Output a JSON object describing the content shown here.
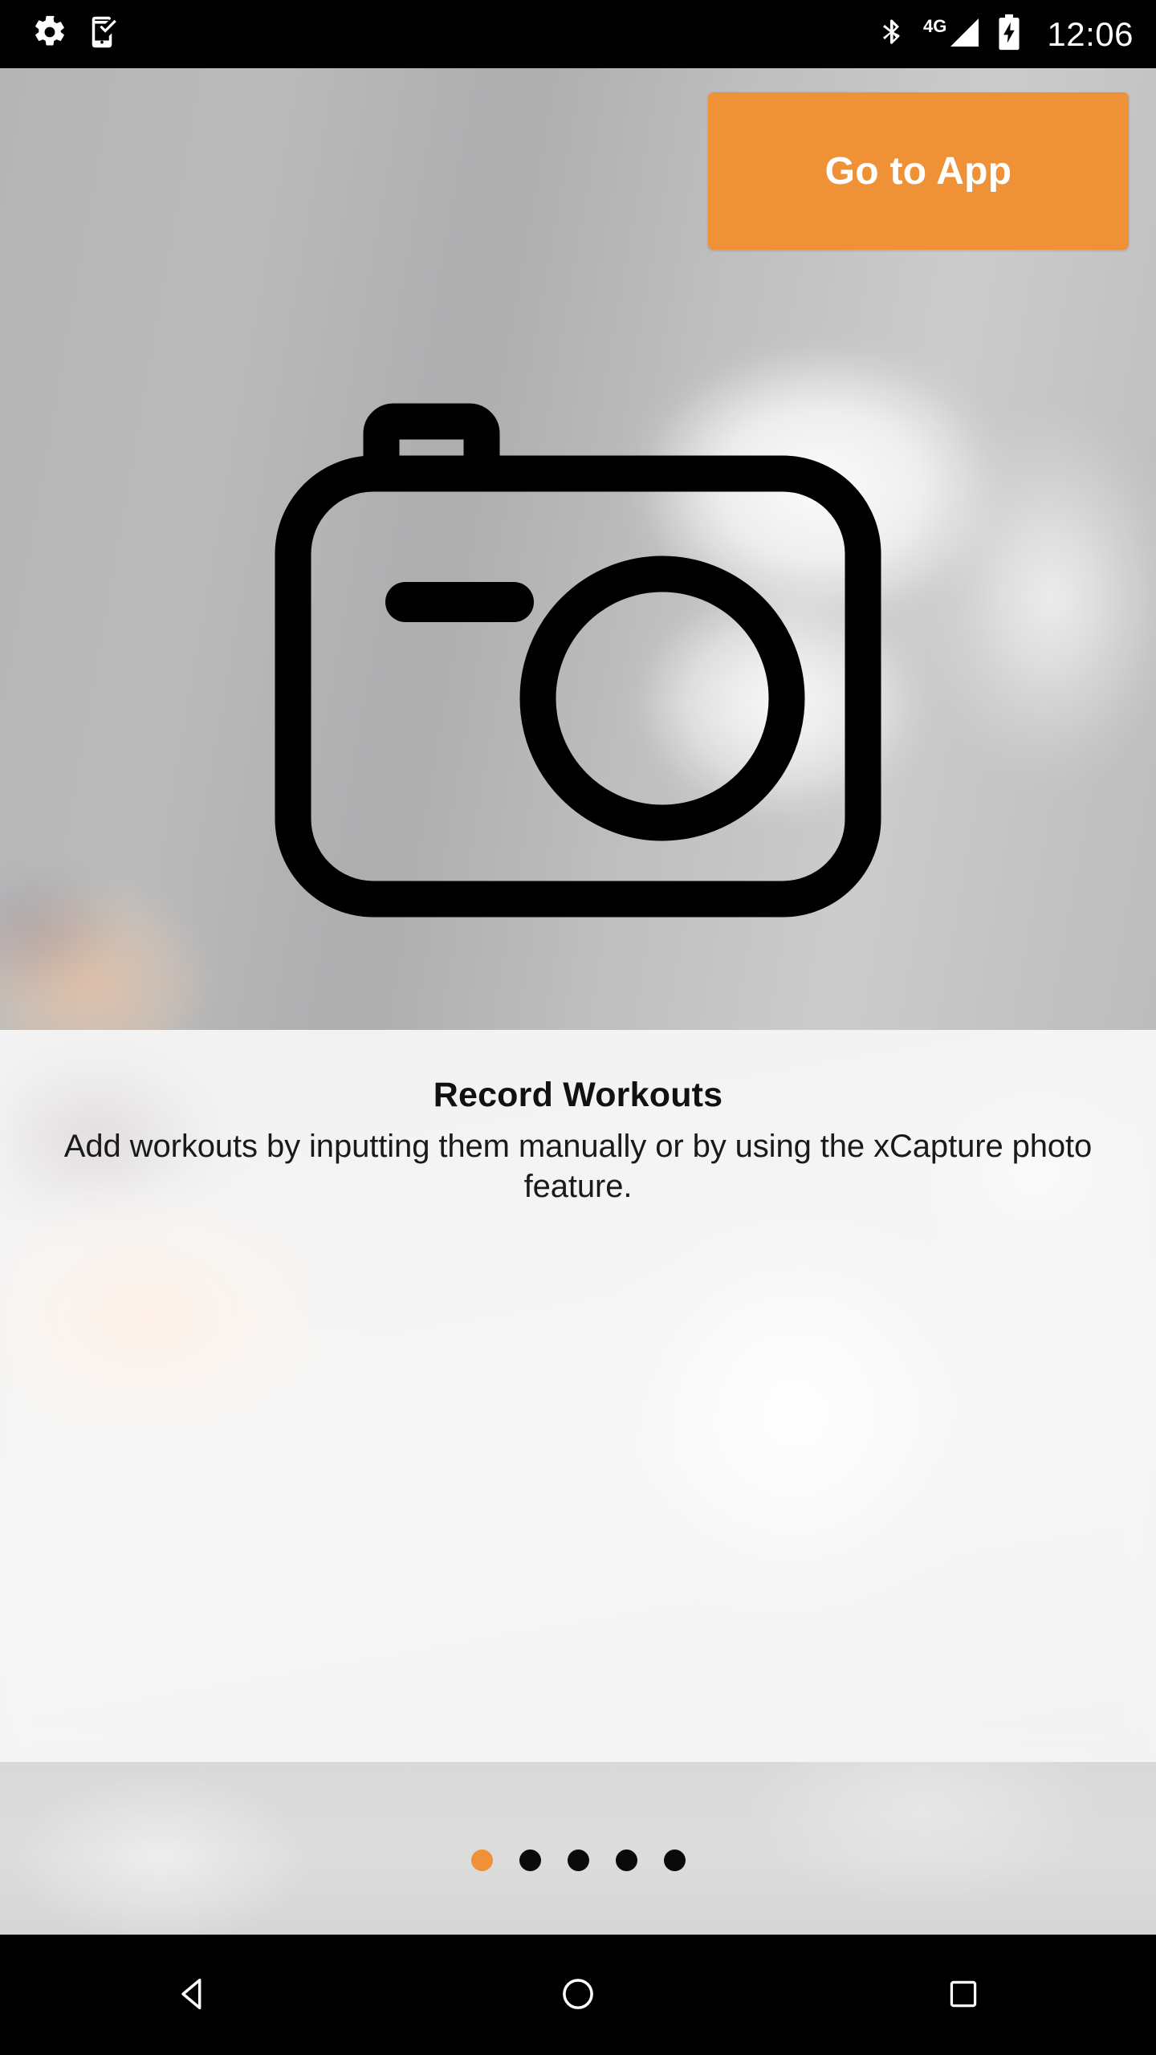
{
  "status_bar": {
    "left_icons": [
      {
        "name": "settings-gear-icon",
        "label": "Settings"
      },
      {
        "name": "phone-check-icon",
        "label": "Device check"
      }
    ],
    "right_icons": [
      {
        "name": "bluetooth-icon",
        "label": "Bluetooth"
      },
      {
        "name": "signal-4g-icon",
        "label": "4G"
      },
      {
        "name": "battery-charging-icon",
        "label": "Battery charging"
      }
    ],
    "network_label": "4G",
    "clock": "12:06"
  },
  "hero": {
    "go_to_app_label": "Go to App",
    "feature_icon": "camera-icon"
  },
  "content": {
    "title": "Record Workouts",
    "description": "Add workouts by inputting them manually or by using the xCapture photo feature."
  },
  "pager": {
    "total": 5,
    "current_index": 0,
    "dots": [
      {
        "active": true
      },
      {
        "active": false
      },
      {
        "active": false
      },
      {
        "active": false
      },
      {
        "active": false
      }
    ]
  },
  "nav_bar": {
    "buttons": [
      {
        "name": "nav-back-button",
        "label": "Back"
      },
      {
        "name": "nav-home-button",
        "label": "Home"
      },
      {
        "name": "nav-recents-button",
        "label": "Recents"
      }
    ]
  },
  "colors": {
    "accent_orange": "#ee9137",
    "status_bar_bg": "#000000",
    "hero_bg": "#b3b3b4",
    "content_bg": "#e6e6e6",
    "footer_bg": "#d9d9da",
    "dot_inactive": "#0a0a0a",
    "text_primary": "#111111"
  }
}
